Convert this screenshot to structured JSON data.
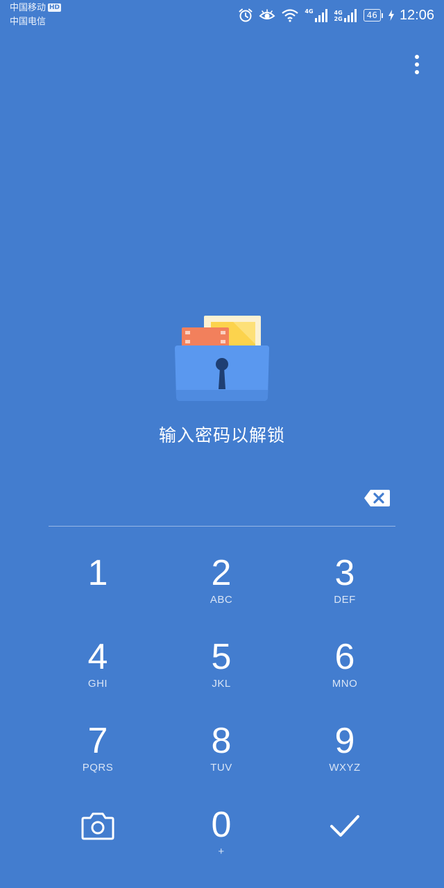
{
  "status_bar": {
    "carrier_1": "中国移动",
    "carrier_1_badge": "HD",
    "carrier_2": "中国电信",
    "network_1": "4G",
    "network_2_top": "4G",
    "network_2_bottom": "2G",
    "battery": "46",
    "time": "12:06"
  },
  "lock_screen": {
    "prompt": "输入密码以解锁",
    "accent_color": "#437dcf",
    "folder_color": "#5a98ef",
    "card_orange": "#f2805c",
    "card_yellow": "#fcd34d"
  },
  "keypad": {
    "keys": [
      {
        "digit": "1",
        "letters": ""
      },
      {
        "digit": "2",
        "letters": "ABC"
      },
      {
        "digit": "3",
        "letters": "DEF"
      },
      {
        "digit": "4",
        "letters": "GHI"
      },
      {
        "digit": "5",
        "letters": "JKL"
      },
      {
        "digit": "6",
        "letters": "MNO"
      },
      {
        "digit": "7",
        "letters": "PQRS"
      },
      {
        "digit": "8",
        "letters": "TUV"
      },
      {
        "digit": "9",
        "letters": "WXYZ"
      }
    ],
    "zero": {
      "digit": "0",
      "letters": "+"
    },
    "left_icon": "camera-icon",
    "right_icon": "checkmark-icon",
    "delete_icon": "backspace-icon"
  }
}
